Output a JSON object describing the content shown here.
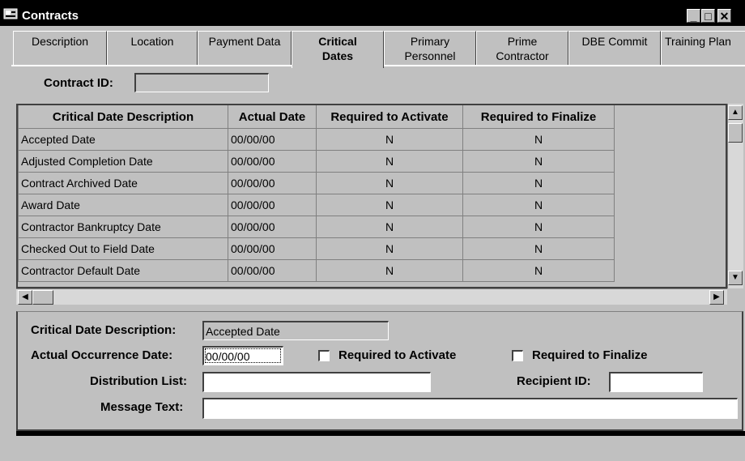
{
  "window": {
    "title": "Contracts",
    "min_glyph": "_",
    "max_glyph": "□",
    "close_glyph": "✕"
  },
  "tabs": [
    {
      "line1": "Description",
      "line2": ""
    },
    {
      "line1": "Location",
      "line2": ""
    },
    {
      "line1": "Payment Data",
      "line2": ""
    },
    {
      "line1": "Critical",
      "line2": "Dates"
    },
    {
      "line1": "Primary",
      "line2": "Personnel"
    },
    {
      "line1": "Prime",
      "line2": "Contractor"
    },
    {
      "line1": "DBE Commit",
      "line2": ""
    },
    {
      "line1": "Training Plan",
      "line2": ""
    }
  ],
  "contract_id": {
    "label": "Contract ID:",
    "value": ""
  },
  "grid": {
    "headers": [
      "Critical Date Description",
      "Actual Date",
      "Required to Activate",
      "Required to Finalize"
    ],
    "rows": [
      [
        "Accepted Date",
        "00/00/00",
        "N",
        "N"
      ],
      [
        "Adjusted Completion Date",
        "00/00/00",
        "N",
        "N"
      ],
      [
        "Contract Archived Date",
        "00/00/00",
        "N",
        "N"
      ],
      [
        "Award Date",
        "00/00/00",
        "N",
        "N"
      ],
      [
        "Contractor Bankruptcy Date",
        "00/00/00",
        "N",
        "N"
      ],
      [
        "Checked Out to Field Date",
        "00/00/00",
        "N",
        "N"
      ],
      [
        "Contractor Default Date",
        "00/00/00",
        "N",
        "N"
      ]
    ]
  },
  "scroll": {
    "up": "▲",
    "down": "▼",
    "left": "◀",
    "right": "▶"
  },
  "detail": {
    "desc_label": "Critical Date Description:",
    "desc_value": "Accepted Date",
    "occ_label": "Actual Occurrence Date:",
    "occ_value": "00/00/00",
    "activate_label": "Required to Activate",
    "finalize_label": "Required to Finalize",
    "dist_label": "Distribution List:",
    "dist_value": "",
    "recip_label": "Recipient ID:",
    "recip_value": "",
    "msg_label": "Message Text:",
    "msg_value": ""
  }
}
